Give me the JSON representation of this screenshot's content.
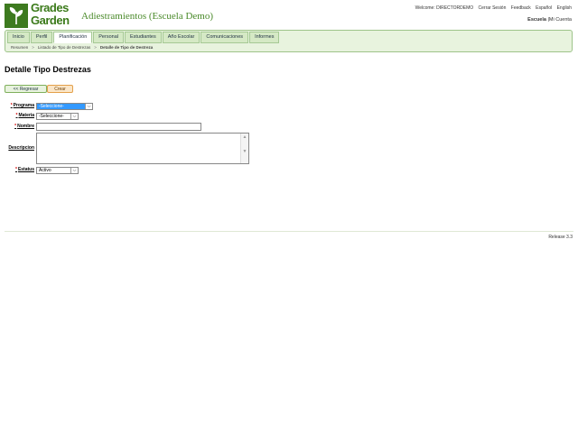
{
  "header": {
    "logo_line1": "Grades",
    "logo_line2": "Garden",
    "app_title": "Adiestramientos (Escuela Demo)",
    "top_links": {
      "welcome": "Welcome: DIRECTORDEMO",
      "logout": "Cerrar Sesión",
      "feedback": "Feedback",
      "espanol": "Español",
      "english": "English"
    },
    "school_label": "Escuela",
    "school_sep": "|",
    "my_account": "Mi Cuenta"
  },
  "nav": {
    "tabs": [
      {
        "label": "Inicio"
      },
      {
        "label": "Perfil"
      },
      {
        "label": "Planificación"
      },
      {
        "label": "Personal"
      },
      {
        "label": "Estudiantes"
      },
      {
        "label": "Año Escolar"
      },
      {
        "label": "Comunicaciones"
      },
      {
        "label": "Informes"
      }
    ],
    "active_tab": "Planificación"
  },
  "breadcrumb": {
    "items": [
      "Resumen",
      "Listado de Tipo de Destrezas",
      "Detalle de Tipo de Destreza"
    ],
    "sep": ">"
  },
  "page": {
    "title": "Detalle Tipo Destrezas",
    "back_button": "<< Regresar",
    "create_button": "Crear"
  },
  "form": {
    "required_mark": "*",
    "programa": {
      "label": "Programa",
      "value": "-Seleccione-"
    },
    "materia": {
      "label": "Materia",
      "value": "-Seleccione-"
    },
    "nombre": {
      "label": "Nombre",
      "value": ""
    },
    "descripcion": {
      "label": "Descripcion",
      "value": ""
    },
    "estatus": {
      "label": "Estatus",
      "value": "Activo"
    }
  },
  "footer": {
    "release": "Release 3.3"
  },
  "colors": {
    "brand_green": "#3b7a1a",
    "nav_bg": "#e8f3de",
    "select_highlight": "#3399ff",
    "required": "#d00000"
  }
}
